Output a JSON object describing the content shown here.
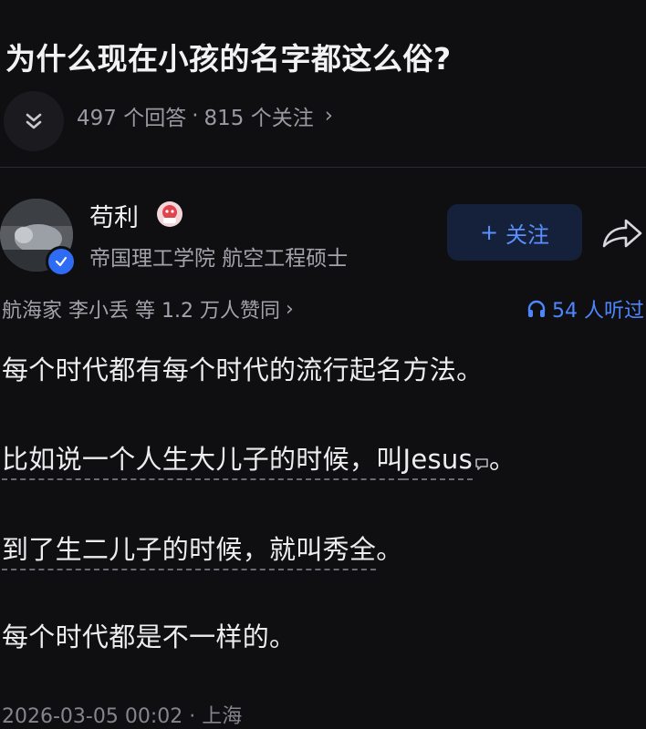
{
  "question": {
    "title": "为什么现在小孩的名字都这么俗?",
    "answers": "497 个回答",
    "separator": "·",
    "followers": "815 个关注",
    "chevron": "›"
  },
  "author": {
    "name": "苟利",
    "description": "帝国理工学院 航空工程硕士",
    "follow_plus": "+",
    "follow_label": "关注"
  },
  "engagement": {
    "likes_text": "航海家 李小丢 等 1.2 万人赞同",
    "likes_chevron": "›",
    "listens_text": "54 人听过"
  },
  "content": {
    "p1": "每个时代都有每个时代的流行起名方法。",
    "p2_a": "比如说一个人生大儿子的时候，叫",
    "p2_b": "Jesus",
    "p2_c": "。",
    "p3_a": "到了生二儿子的时候，就叫秀全",
    "p3_b": "。",
    "p4": "每个时代都是不一样的。"
  },
  "meta": {
    "footer": "2026-03-05 00:02 · 上海"
  },
  "colors": {
    "background": "#0f0f12",
    "accent": "#4d86ff",
    "follow_bg": "#15213a",
    "verified": "#2f6cf5"
  },
  "icons": {
    "collapse": "double-chevron-down-icon",
    "share": "share-arrow-icon",
    "listen": "headphones-icon",
    "verified": "check-badge-icon",
    "comment": "comment-bubble-icon"
  }
}
